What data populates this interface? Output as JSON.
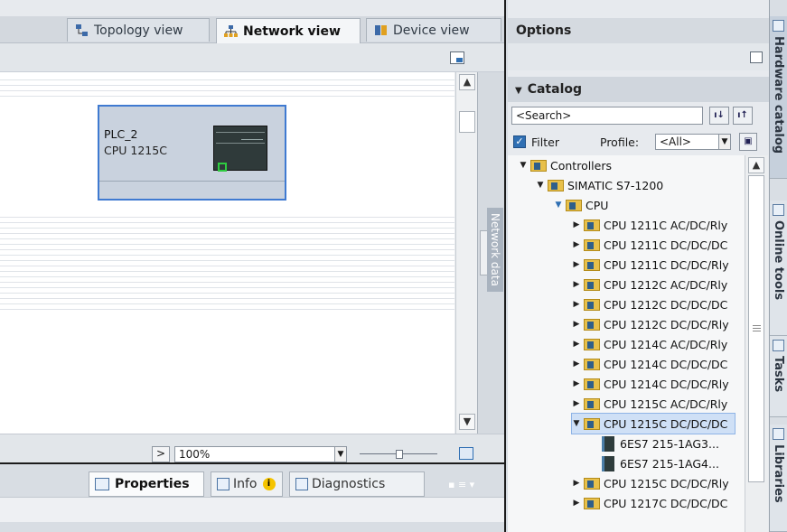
{
  "view_tabs": [
    {
      "label": "Topology view",
      "icon": "topology-icon",
      "active": false
    },
    {
      "label": "Network view",
      "icon": "network-icon",
      "active": true
    },
    {
      "label": "Device view",
      "icon": "device-icon",
      "active": false
    }
  ],
  "side_label": "Network data",
  "device": {
    "name": "PLC_2",
    "type": "CPU 1215C"
  },
  "zoom": {
    "value": "100%"
  },
  "inspector_tabs": [
    {
      "label": "Properties",
      "icon": "properties-icon",
      "active": true
    },
    {
      "label": "Info",
      "icon": "info-icon",
      "active": false
    },
    {
      "label": "Diagnostics",
      "icon": "diagnostics-icon",
      "active": false
    }
  ],
  "options": {
    "title": "Options"
  },
  "catalog": {
    "title": "Catalog",
    "search_placeholder": "<Search>",
    "filter_label": "Filter",
    "filter_checked": true,
    "profile_label": "Profile:",
    "profile_value": "<All>"
  },
  "tree": [
    {
      "label": "Controllers",
      "level": 0,
      "expanded": true,
      "kind": "folder"
    },
    {
      "label": "SIMATIC S7-1200",
      "level": 1,
      "expanded": true,
      "kind": "folder"
    },
    {
      "label": "CPU",
      "level": 2,
      "expanded": true,
      "kind": "folder"
    },
    {
      "label": "CPU 1211C AC/DC/Rly",
      "level": 3,
      "expanded": false,
      "kind": "folder"
    },
    {
      "label": "CPU 1211C DC/DC/DC",
      "level": 3,
      "expanded": false,
      "kind": "folder"
    },
    {
      "label": "CPU 1211C DC/DC/Rly",
      "level": 3,
      "expanded": false,
      "kind": "folder"
    },
    {
      "label": "CPU 1212C AC/DC/Rly",
      "level": 3,
      "expanded": false,
      "kind": "folder"
    },
    {
      "label": "CPU 1212C DC/DC/DC",
      "level": 3,
      "expanded": false,
      "kind": "folder"
    },
    {
      "label": "CPU 1212C DC/DC/Rly",
      "level": 3,
      "expanded": false,
      "kind": "folder"
    },
    {
      "label": "CPU 1214C AC/DC/Rly",
      "level": 3,
      "expanded": false,
      "kind": "folder"
    },
    {
      "label": "CPU 1214C DC/DC/DC",
      "level": 3,
      "expanded": false,
      "kind": "folder"
    },
    {
      "label": "CPU 1214C DC/DC/Rly",
      "level": 3,
      "expanded": false,
      "kind": "folder"
    },
    {
      "label": "CPU 1215C AC/DC/Rly",
      "level": 3,
      "expanded": false,
      "kind": "folder"
    },
    {
      "label": "CPU 1215C DC/DC/DC",
      "level": 3,
      "expanded": true,
      "kind": "folder",
      "selected": true
    },
    {
      "label": "6ES7 215-1AG3...",
      "level": 4,
      "kind": "module"
    },
    {
      "label": "6ES7 215-1AG4...",
      "level": 4,
      "kind": "module"
    },
    {
      "label": "CPU 1215C DC/DC/Rly",
      "level": 3,
      "expanded": false,
      "kind": "folder"
    },
    {
      "label": "CPU 1217C DC/DC/DC",
      "level": 3,
      "expanded": false,
      "kind": "folder"
    }
  ],
  "side_tabs": [
    {
      "label": "Hardware catalog",
      "active": true
    },
    {
      "label": "Online tools",
      "active": false
    },
    {
      "label": "Tasks",
      "active": false
    },
    {
      "label": "Libraries",
      "active": false
    }
  ]
}
